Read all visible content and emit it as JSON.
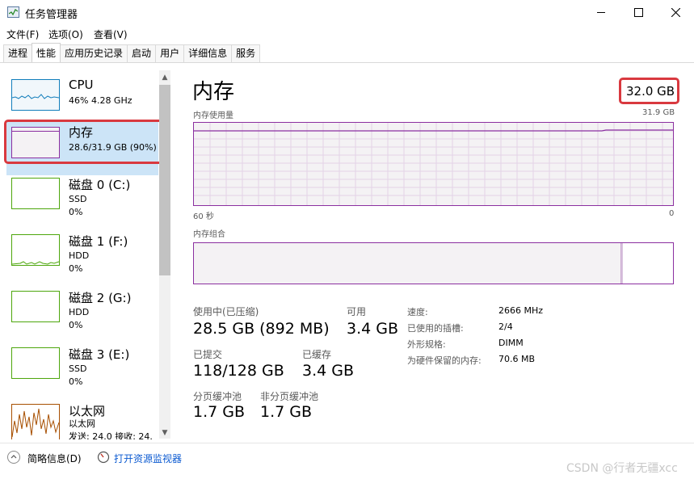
{
  "window": {
    "title": "任务管理器",
    "minimize_icon": "minimize-icon",
    "maximize_icon": "maximize-icon",
    "close_icon": "close-icon"
  },
  "menu": [
    "文件(F)",
    "选项(O)",
    "查看(V)"
  ],
  "tabs": [
    "进程",
    "性能",
    "应用历史记录",
    "启动",
    "用户",
    "详细信息",
    "服务"
  ],
  "active_tab": "性能",
  "sidebar": {
    "items": [
      {
        "name": "CPU",
        "sub1": "46%  4.28 GHz",
        "sub2": "",
        "color": "#117dbb"
      },
      {
        "name": "内存",
        "sub1": "28.6/31.9 GB (90%)",
        "sub2": "",
        "color": "#8b2fa0",
        "selected": true
      },
      {
        "name": "磁盘 0 (C:)",
        "sub1": "SSD",
        "sub2": "0%",
        "color": "#4da60c"
      },
      {
        "name": "磁盘 1 (F:)",
        "sub1": "HDD",
        "sub2": "0%",
        "color": "#4da60c"
      },
      {
        "name": "磁盘 2 (G:)",
        "sub1": "HDD",
        "sub2": "0%",
        "color": "#4da60c"
      },
      {
        "name": "磁盘 3 (E:)",
        "sub1": "SSD",
        "sub2": "0%",
        "color": "#4da60c"
      },
      {
        "name": "以太网",
        "sub1": "以太网",
        "sub2": "发送: 24.0  接收: 24.",
        "color": "#a74f01"
      }
    ]
  },
  "memory": {
    "title": "内存",
    "total": "32.0 GB",
    "usage_label": "内存使用量",
    "usage_max": "31.9 GB",
    "time_left": "60 秒",
    "time_right": "0",
    "composition_label": "内存组合",
    "usage_fraction": 0.9,
    "composition_fraction": 0.89,
    "stats": {
      "in_use_label": "使用中(已压缩)",
      "in_use_value": "28.5 GB (892 MB)",
      "available_label": "可用",
      "available_value": "3.4 GB",
      "committed_label": "已提交",
      "committed_value": "118/128 GB",
      "cached_label": "已缓存",
      "cached_value": "3.4 GB",
      "paged_label": "分页缓冲池",
      "paged_value": "1.7 GB",
      "nonpaged_label": "非分页缓冲池",
      "nonpaged_value": "1.7 GB"
    },
    "specs": [
      {
        "label": "速度:",
        "value": "2666 MHz"
      },
      {
        "label": "已使用的插槽:",
        "value": "2/4"
      },
      {
        "label": "外形规格:",
        "value": "DIMM"
      },
      {
        "label": "为硬件保留的内存:",
        "value": "70.6 MB"
      }
    ]
  },
  "footer": {
    "summary": "简略信息(D)",
    "monitor_link": "打开资源监视器"
  },
  "watermark": "CSDN @行者无疆xcc",
  "colors": {
    "memory": "#8b2fa0",
    "cpu": "#117dbb",
    "disk": "#4da60c",
    "ethernet": "#a74f01",
    "highlight": "#d9393f",
    "selection": "#cce4f7"
  }
}
